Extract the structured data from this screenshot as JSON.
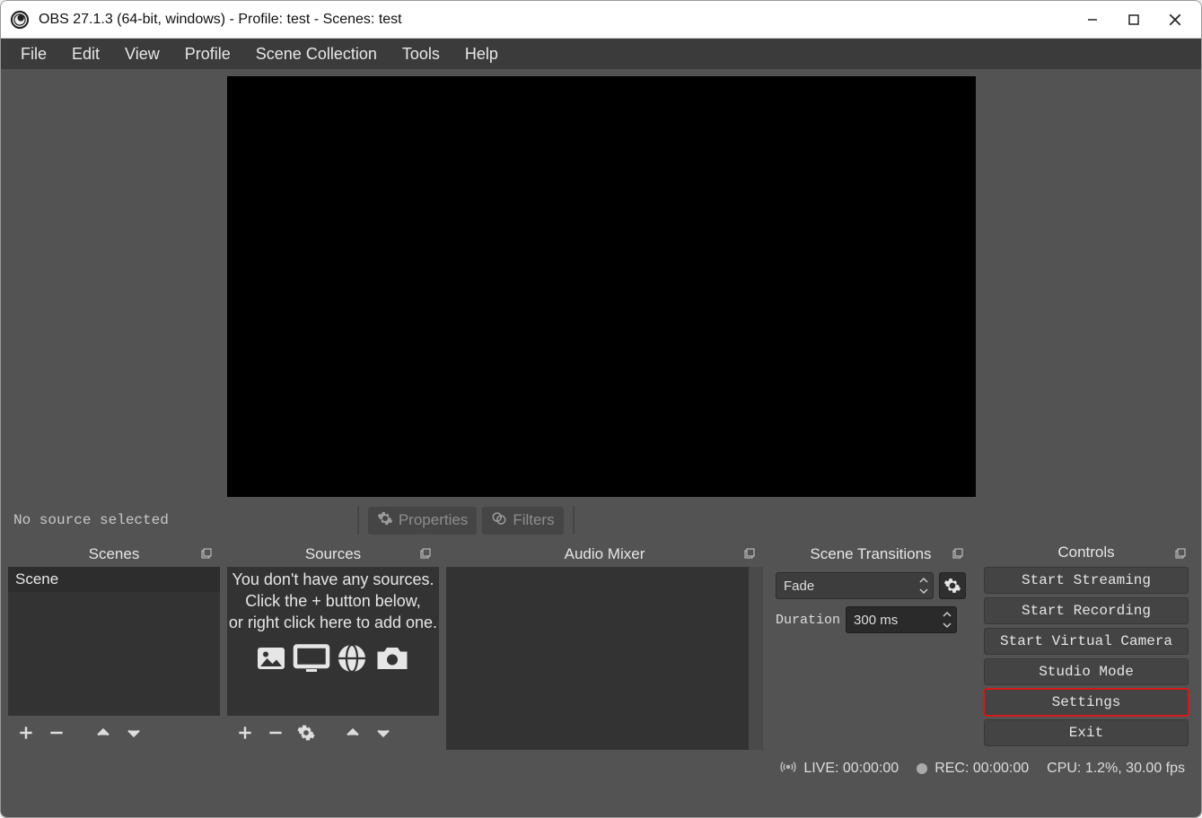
{
  "titlebar": {
    "title": "OBS 27.1.3 (64-bit, windows) - Profile: test - Scenes: test"
  },
  "menu": {
    "file": "File",
    "edit": "Edit",
    "view": "View",
    "profile": "Profile",
    "scene_collection": "Scene Collection",
    "tools": "Tools",
    "help": "Help"
  },
  "toolbar": {
    "no_source": "No source selected",
    "properties": "Properties",
    "filters": "Filters"
  },
  "docks": {
    "scenes": {
      "title": "Scenes",
      "items": [
        "Scene"
      ]
    },
    "sources": {
      "title": "Sources",
      "empty_l1": "You don't have any sources.",
      "empty_l2": "Click the + button below,",
      "empty_l3": "or right click here to add one."
    },
    "mixer": {
      "title": "Audio Mixer"
    },
    "transitions": {
      "title": "Scene Transitions",
      "current": "Fade",
      "duration_label": "Duration",
      "duration_value": "300 ms"
    },
    "controls": {
      "title": "Controls",
      "start_streaming": "Start Streaming",
      "start_recording": "Start Recording",
      "start_virtual_camera": "Start Virtual Camera",
      "studio_mode": "Studio Mode",
      "settings": "Settings",
      "exit": "Exit"
    }
  },
  "statusbar": {
    "live": "LIVE: 00:00:00",
    "rec": "REC: 00:00:00",
    "cpu": "CPU: 1.2%, 30.00 fps"
  }
}
